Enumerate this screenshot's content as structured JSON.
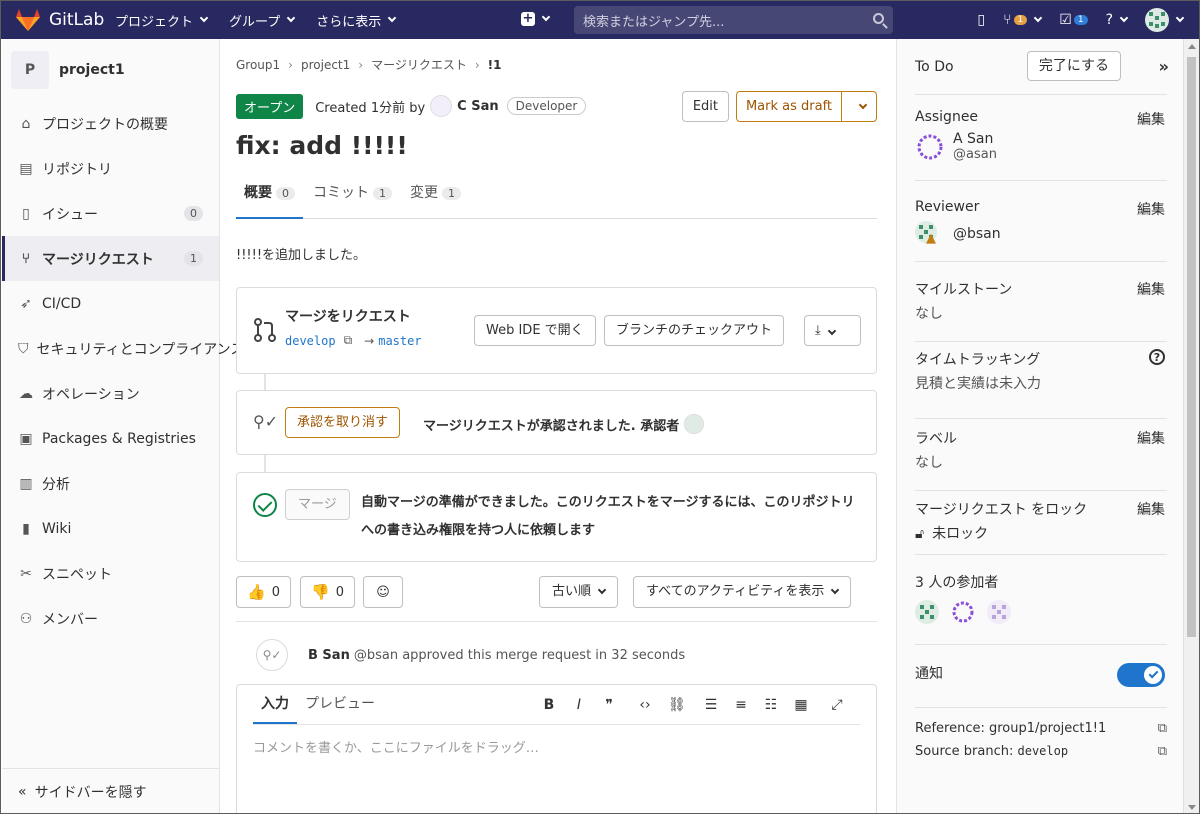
{
  "topbar": {
    "brand": "GitLab",
    "nav": [
      "プロジェクト",
      "グループ",
      "さらに表示"
    ],
    "search_placeholder": "検索またはジャンプ先...",
    "mr_badge": "1",
    "todo_badge": "1"
  },
  "sidebar": {
    "project_initial": "P",
    "project_name": "project1",
    "items": [
      {
        "label": "プロジェクトの概要",
        "icon": "home-icon",
        "count": ""
      },
      {
        "label": "リポジトリ",
        "icon": "doc-icon",
        "count": ""
      },
      {
        "label": "イシュー",
        "icon": "issues-icon",
        "count": "0"
      },
      {
        "label": "マージリクエスト",
        "icon": "merge-request-icon",
        "count": "1"
      },
      {
        "label": "CI/CD",
        "icon": "rocket-icon",
        "count": ""
      },
      {
        "label": "セキュリティとコンプライアンス",
        "icon": "shield-icon",
        "count": ""
      },
      {
        "label": "オペレーション",
        "icon": "cloud-icon",
        "count": ""
      },
      {
        "label": "Packages & Registries",
        "icon": "package-icon",
        "count": ""
      },
      {
        "label": "分析",
        "icon": "chart-icon",
        "count": ""
      },
      {
        "label": "Wiki",
        "icon": "book-icon",
        "count": ""
      },
      {
        "label": "スニペット",
        "icon": "scissors-icon",
        "count": ""
      },
      {
        "label": "メンバー",
        "icon": "users-icon",
        "count": ""
      }
    ],
    "hide_label": "サイドバーを隠す"
  },
  "breadcrumb": [
    "Group1",
    "project1",
    "マージリクエスト",
    "!1"
  ],
  "mr": {
    "status": "オープン",
    "created_prefix": "Created 1分前 by",
    "author": "C San",
    "role": "Developer",
    "edit_label": "Edit",
    "draft_label": "Mark as draft",
    "title": "fix: add !!!!!",
    "tabs": [
      {
        "label": "概要",
        "count": "0"
      },
      {
        "label": "コミット",
        "count": "1"
      },
      {
        "label": "変更",
        "count": "1"
      }
    ],
    "description": "!!!!!を追加しました。"
  },
  "widget": {
    "title": "マージをリクエスト",
    "source_branch": "develop",
    "target_branch": "master",
    "arrow": "→",
    "web_ide": "Web IDE で開く",
    "checkout": "ブランチのチェックアウト",
    "revoke": "承認を取り消す",
    "approved_text": "マージリクエストが承認されました. 承認者",
    "merge_btn": "マージ",
    "merge_text": "自動マージの準備ができました。このリクエストをマージするには、このリポジトリへの書き込み権限を持つ人に依頼します"
  },
  "reactions": {
    "thumbs_up": "0",
    "thumbs_down": "0"
  },
  "sort": {
    "order": "古い順",
    "filter": "すべてのアクティビティを表示"
  },
  "activity": {
    "user": "B San",
    "text": "@bsan approved this merge request in 32 seconds"
  },
  "editor": {
    "tab_write": "入力",
    "tab_preview": "プレビュー",
    "placeholder": "コメントを書くか、ここにファイルをドラッグ…"
  },
  "right": {
    "todo": "To Do",
    "done_btn": "完了にする",
    "edit": "編集",
    "assignee_label": "Assignee",
    "assignee_name": "A San",
    "assignee_handle": "@asan",
    "reviewer_label": "Reviewer",
    "reviewer_handle": "@bsan",
    "milestone_label": "マイルストーン",
    "milestone_value": "なし",
    "time_label": "タイムトラッキング",
    "time_value": "見積と実績は未入力",
    "label_label": "ラベル",
    "label_value": "なし",
    "lock_label": "マージリクエスト をロック",
    "lock_value": "未ロック",
    "participants": "3 人の参加者",
    "notify": "通知",
    "reference": "Reference: group1/project1!1",
    "source_branch_label": "Source branch:",
    "source_branch_value": "develop"
  },
  "colors": {
    "topbar": "#292961",
    "open": "#108548",
    "draft": "#c17d10",
    "link": "#1f75cb"
  }
}
